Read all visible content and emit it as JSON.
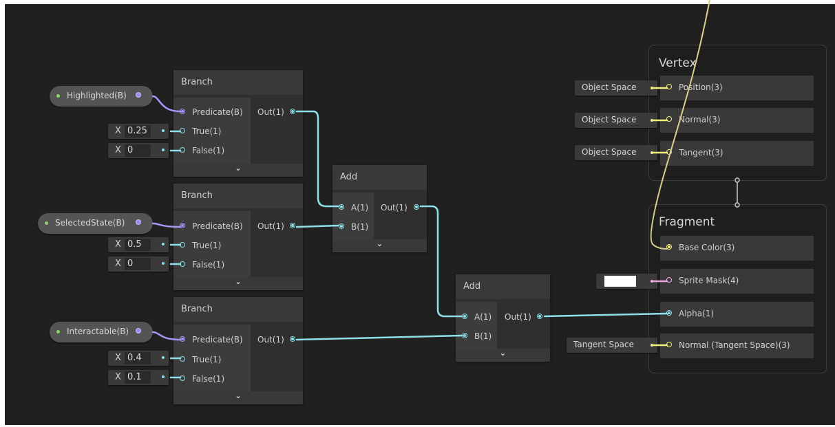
{
  "properties": [
    {
      "label": "Highlighted(B)"
    },
    {
      "label": "SelectedState(B)"
    },
    {
      "label": "Interactable(B)"
    }
  ],
  "branch_nodes": [
    {
      "title": "Branch",
      "predicate": "Predicate(B)",
      "true": "True(1)",
      "false": "False(1)",
      "out": "Out(1)",
      "true_value": "0.25",
      "false_value": "0"
    },
    {
      "title": "Branch",
      "predicate": "Predicate(B)",
      "true": "True(1)",
      "false": "False(1)",
      "out": "Out(1)",
      "true_value": "0.5",
      "false_value": "0"
    },
    {
      "title": "Branch",
      "predicate": "Predicate(B)",
      "true": "True(1)",
      "false": "False(1)",
      "out": "Out(1)",
      "true_value": "0.4",
      "false_value": "0.1"
    }
  ],
  "add_nodes": [
    {
      "title": "Add",
      "a": "A(1)",
      "b": "B(1)",
      "out": "Out(1)"
    },
    {
      "title": "Add",
      "a": "A(1)",
      "b": "B(1)",
      "out": "Out(1)"
    }
  ],
  "value_axis_label": "X",
  "chevron": "⌄",
  "vertex": {
    "title": "Vertex",
    "blocks": [
      {
        "label": "Position(3)",
        "space": "Object Space"
      },
      {
        "label": "Normal(3)",
        "space": "Object Space"
      },
      {
        "label": "Tangent(3)",
        "space": "Object Space"
      }
    ]
  },
  "fragment": {
    "title": "Fragment",
    "blocks": [
      {
        "label": "Base Color(3)"
      },
      {
        "label": "Sprite Mask(4)"
      },
      {
        "label": "Alpha(1)"
      },
      {
        "label": "Normal (Tangent Space)(3)",
        "space": "Tangent Space"
      }
    ]
  },
  "colors": {
    "canvas": "#202020",
    "float_wire": "#8ee0ea",
    "bool_wire": "#a895f7",
    "vector_wire": "#d8d08a"
  }
}
